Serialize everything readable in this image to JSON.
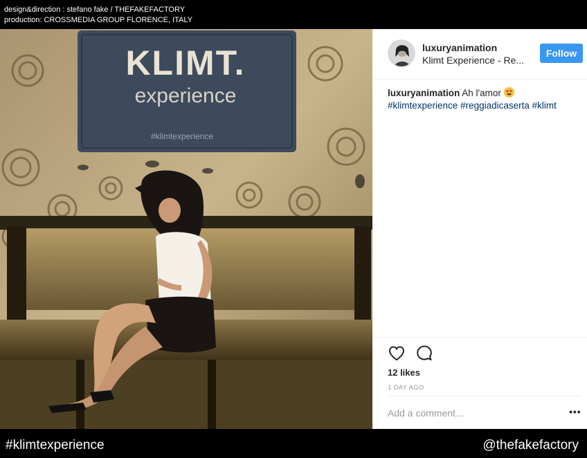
{
  "credits": {
    "line1": "design&direction : stefano fake / THEFAKEFACTORY",
    "line2": "production: CROSSMEDIA GROUP FLORENCE, ITALY"
  },
  "photo": {
    "sign_title": "KLIMT.",
    "sign_subtitle": "experience",
    "sign_hashtag": "#klimtexperience"
  },
  "post": {
    "username": "luxuryanimation",
    "location": "Klimt Experience - Re...",
    "follow_label": "Follow",
    "caption": {
      "username": "luxuryanimation",
      "text": "Ah l'amor",
      "emoji": "heart-eyes-emoji",
      "hashtags": [
        "#klimtexperience",
        "#reggiadicaserta",
        "#klimt"
      ]
    },
    "likes": "12 likes",
    "time": "1 DAY AGO",
    "comment_placeholder": "Add a comment...",
    "more_label": "•••",
    "icons": {
      "like": "heart-outline-icon",
      "comment": "speech-bubble-icon"
    }
  },
  "footer": {
    "left": "#klimtexperience",
    "right": "@thefakefactory"
  },
  "colors": {
    "follow": "#3897f0",
    "hashtag": "#003569",
    "sign": "#3d4a5c"
  }
}
